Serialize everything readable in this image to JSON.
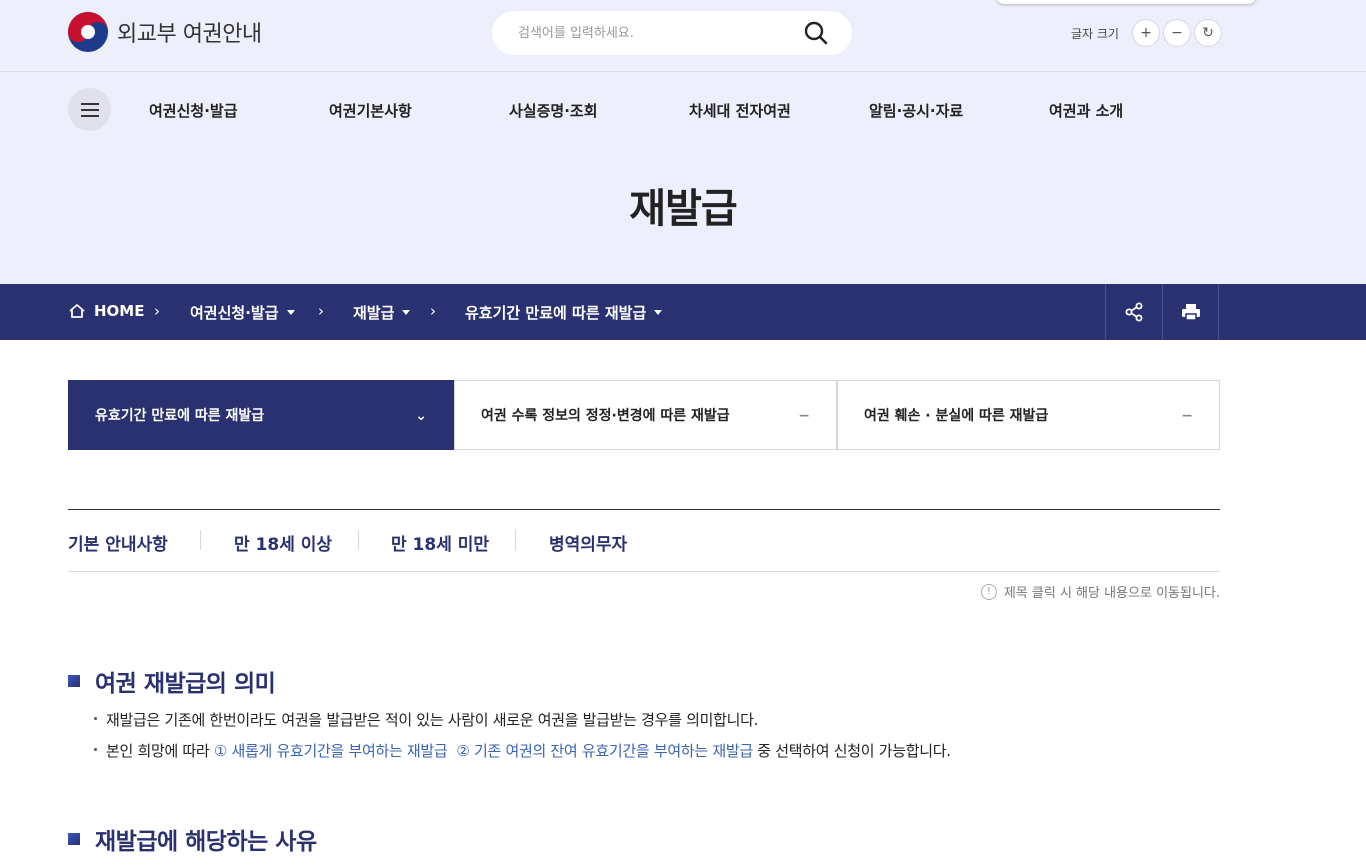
{
  "header": {
    "logo_text": "외교부 여권안내",
    "search": {
      "placeholder": "검색어를 입력하세요."
    },
    "font_size": {
      "label": "글자 크기",
      "increase": "+",
      "decrease": "−",
      "reset": "↻"
    }
  },
  "gnb": {
    "items": [
      {
        "label": "여권신청·발급"
      },
      {
        "label": "여권기본사항"
      },
      {
        "label": "사실증명·조회"
      },
      {
        "label": "차세대 전자여권"
      },
      {
        "label": "알림·공시·자료"
      },
      {
        "label": "여권과 소개"
      }
    ]
  },
  "page_title": "재발급",
  "breadcrumb": {
    "home": "HOME",
    "items": [
      {
        "label": "여권신청·발급"
      },
      {
        "label": "재발급"
      },
      {
        "label": "유효기간 만료에 따른 재발급"
      }
    ]
  },
  "tabs": [
    {
      "label": "유효기간 만료에 따른 재발급",
      "mark": "⌄",
      "active": true
    },
    {
      "label": "여권 수록 정보의 정정·변경에 따른 재발급",
      "mark": "−"
    },
    {
      "label": "여권 훼손 · 분실에 따른 재발급",
      "mark": "−"
    }
  ],
  "subtabs": [
    {
      "label": "기본 안내사항"
    },
    {
      "label": "만 18세 이상"
    },
    {
      "label": "만 18세 미만"
    },
    {
      "label": "병역의무자"
    }
  ],
  "hint": {
    "icon": "!",
    "text": "제목 클릭 시 해당 내용으로 이동됩니다."
  },
  "sections": [
    {
      "title": "여권 재발급의 의미",
      "bullet1": "재발급은 기존에 한번이라도 여권을 발급받은 적이 있는 사람이 새로운 여권을 발급받는 경우를 의미합니다.",
      "bullet2_prefix": "본인 희망에 따라 ",
      "bullet2_link1": "① 새롭게 유효기간을 부여하는 재발급",
      "bullet2_link2": "② 기존 여권의 잔여 유효기간을 부여하는 재발급",
      "bullet2_suffix": " 중 선택하여 신청이 가능합니다."
    },
    {
      "title": "재발급에 해당하는 사유"
    }
  ],
  "colors": {
    "primary": "#2a3170",
    "header_bg": "#eeeffc",
    "link": "#3a65b5"
  }
}
